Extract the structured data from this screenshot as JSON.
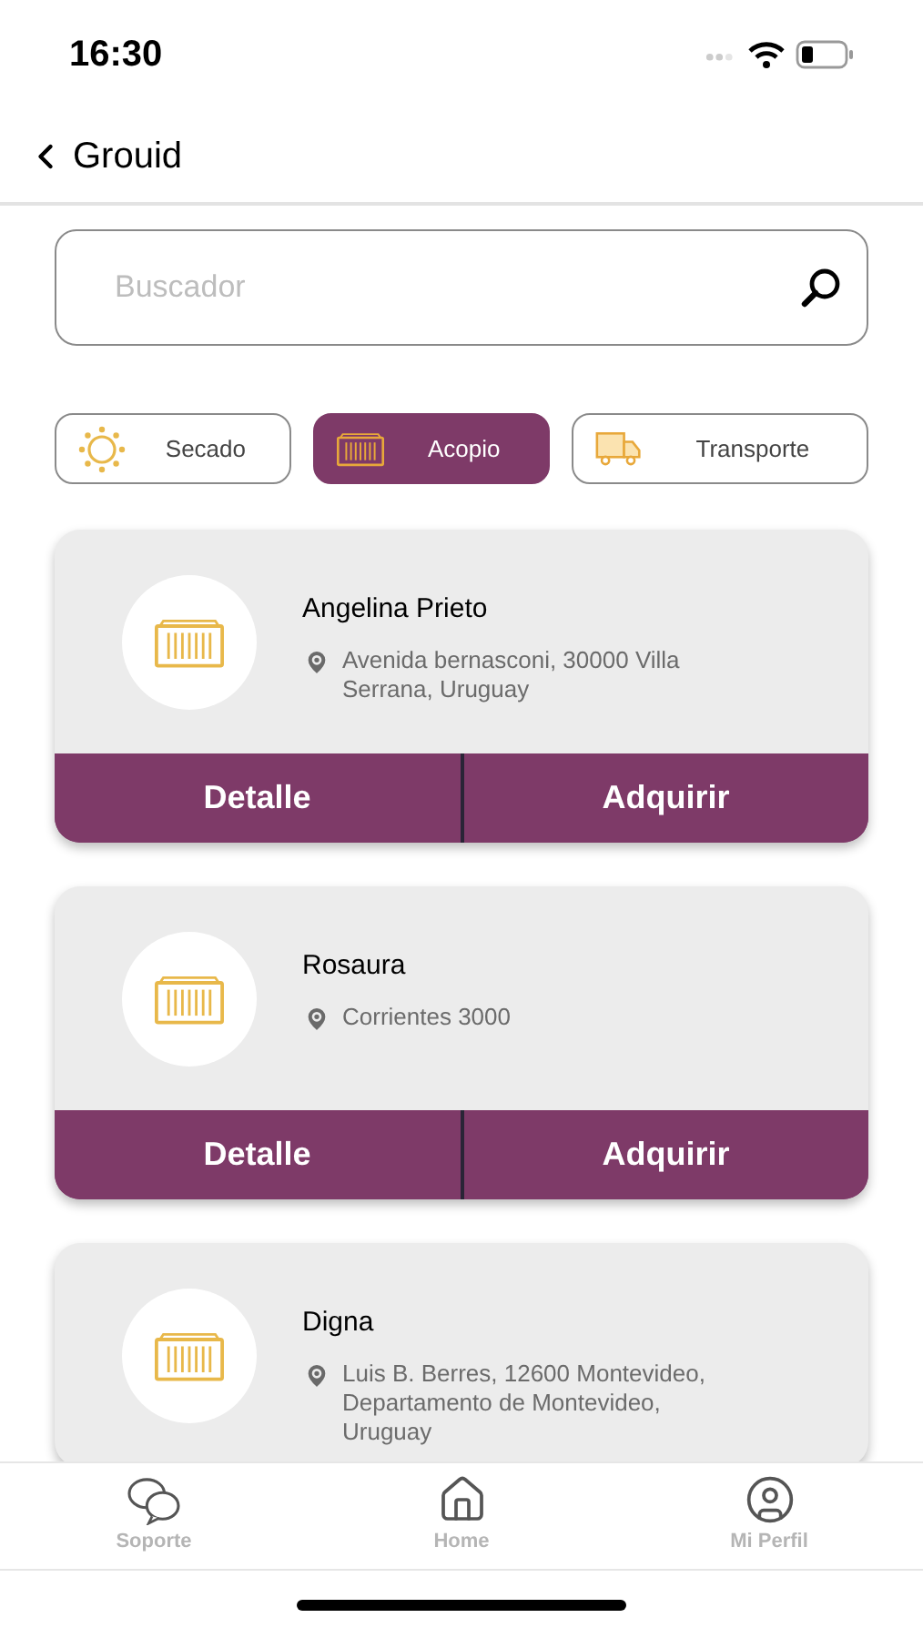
{
  "status_bar": {
    "time": "16:30"
  },
  "header": {
    "back_label": "Grouid"
  },
  "search": {
    "placeholder": "Buscador"
  },
  "filters": [
    {
      "label": "Secado",
      "kind": "sun",
      "selected": false
    },
    {
      "label": "Acopio",
      "kind": "crate",
      "selected": true
    },
    {
      "label": "Transporte",
      "kind": "truck",
      "selected": false
    }
  ],
  "cards": [
    {
      "name": "Angelina Prieto",
      "address": "Avenida bernasconi, 30000 Villa Serrana, Uruguay",
      "buttons": [
        "Detalle",
        "Adquirir"
      ]
    },
    {
      "name": "Rosaura",
      "address": "Corrientes 3000",
      "buttons": [
        "Detalle",
        "Adquirir"
      ]
    },
    {
      "name": "Digna",
      "address": "Luis B. Berres, 12600 Montevideo, Departamento de Montevideo, Uruguay"
    }
  ],
  "tab_bar": [
    {
      "label": "Soporte",
      "kind": "chat"
    },
    {
      "label": "Home",
      "kind": "home"
    },
    {
      "label": "Mi Perfil",
      "kind": "profile"
    }
  ]
}
